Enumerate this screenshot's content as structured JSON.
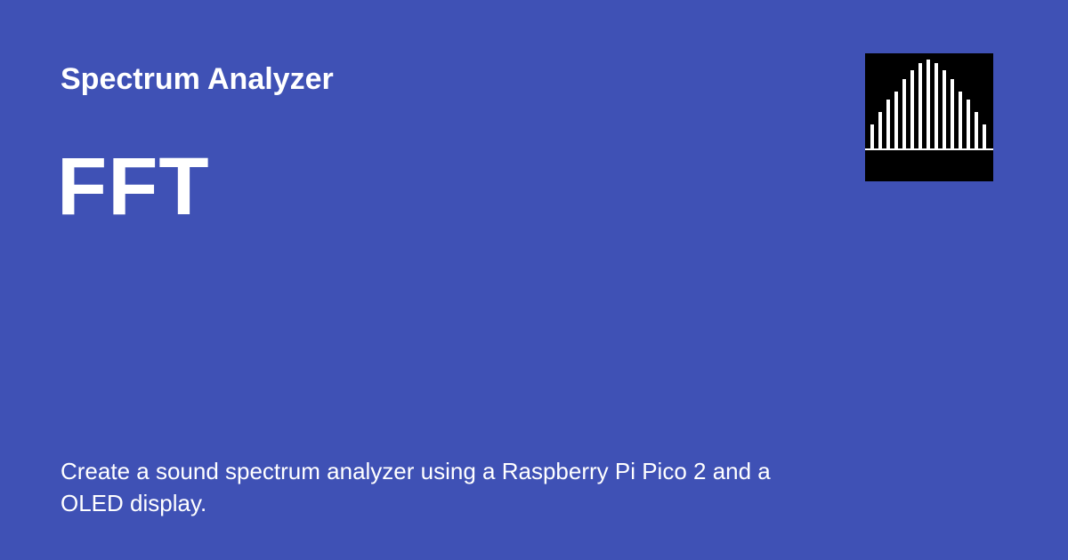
{
  "header": {
    "site_title": "Spectrum Analyzer"
  },
  "main": {
    "title": "FFT",
    "description": "Create a sound spectrum analyzer using a Raspberry Pi Pico 2 and a OLED display."
  },
  "logo": {
    "icon": "spectrum-bars-icon",
    "bar_levels": [
      0.27,
      0.41,
      0.55,
      0.64,
      0.78,
      0.88,
      0.96,
      1.0,
      0.96,
      0.88,
      0.78,
      0.64,
      0.55,
      0.41,
      0.27
    ]
  },
  "colors": {
    "background": "#3f51b5",
    "text": "#ffffff",
    "logo_background": "#000000",
    "logo_bars": "#ffffff"
  }
}
